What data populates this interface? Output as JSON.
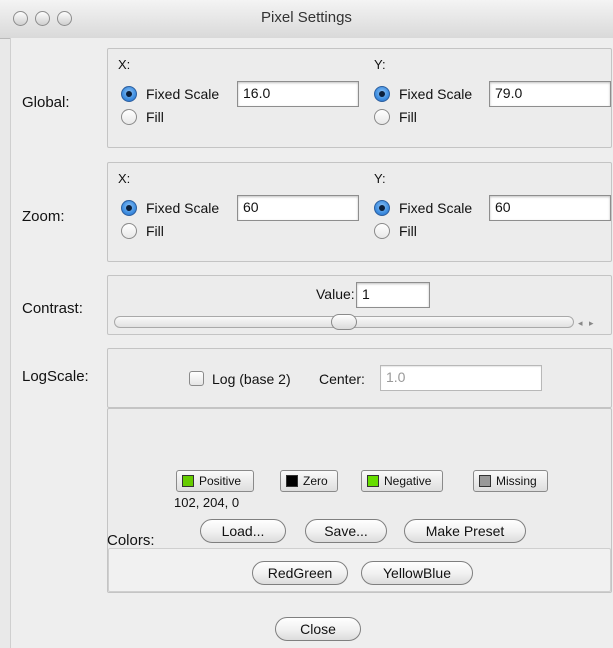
{
  "window": {
    "title": "Pixel Settings",
    "traffic_lights": [
      "close-icon",
      "minimize-icon",
      "zoom-icon"
    ]
  },
  "global": {
    "label": "Global:",
    "x": {
      "label": "X:",
      "mode_fixed_label": "Fixed Scale",
      "mode_fill_label": "Fill",
      "selected": "Fixed Scale",
      "value": "16.0"
    },
    "y": {
      "label": "Y:",
      "mode_fixed_label": "Fixed Scale",
      "mode_fill_label": "Fill",
      "selected": "Fixed Scale",
      "value": "79.0"
    }
  },
  "zoom": {
    "label": "Zoom:",
    "x": {
      "label": "X:",
      "mode_fixed_label": "Fixed Scale",
      "mode_fill_label": "Fill",
      "selected": "Fixed Scale",
      "value": "60"
    },
    "y": {
      "label": "Y:",
      "mode_fixed_label": "Fixed Scale",
      "mode_fill_label": "Fill",
      "selected": "Fixed Scale",
      "value": "60"
    }
  },
  "contrast": {
    "label": "Contrast:",
    "value_label": "Value:",
    "value": "1",
    "slider_level": 0.5
  },
  "logscale": {
    "label": "LogScale:",
    "checkbox_label": "Log (base 2)",
    "checked": false,
    "center_label": "Center:",
    "center_value": "1.0"
  },
  "colors": {
    "label": "Colors:",
    "buttons": [
      {
        "label": "Positive",
        "color": "#66cc00"
      },
      {
        "label": "Zero",
        "color": "#000000"
      },
      {
        "label": "Negative",
        "color": "#66dd00"
      },
      {
        "label": "Missing",
        "color": "#999999"
      }
    ],
    "rgb_readout": "102, 204, 0",
    "load_label": "Load...",
    "save_label": "Save...",
    "make_preset_label": "Make Preset",
    "presets": [
      "RedGreen",
      "YellowBlue"
    ]
  },
  "close_label": "Close"
}
